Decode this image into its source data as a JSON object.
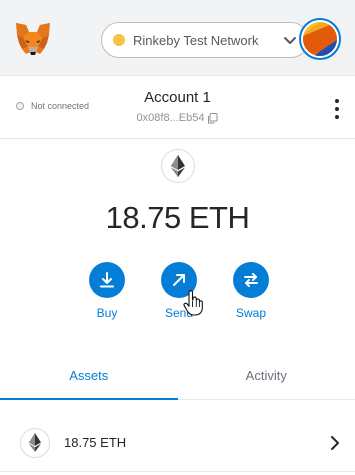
{
  "header": {
    "network": {
      "name": "Rinkeby Test Network",
      "dot_color": "#f6c343"
    },
    "logo_icon": "metamask-fox-icon",
    "avatar_icon": "account-identicon"
  },
  "account": {
    "connection_status": "Not connected",
    "name": "Account 1",
    "address_short": "0x08f8...Eb54",
    "copy_icon": "copy-icon",
    "menu_icon": "kebab-menu-icon"
  },
  "balance": {
    "amount": "18.75 ETH",
    "token_icon": "ethereum-icon"
  },
  "actions": [
    {
      "label": "Buy",
      "icon": "download-icon"
    },
    {
      "label": "Send",
      "icon": "arrow-up-right-icon"
    },
    {
      "label": "Swap",
      "icon": "swap-arrows-icon"
    }
  ],
  "tabs": [
    {
      "label": "Assets",
      "active": true
    },
    {
      "label": "Activity",
      "active": false
    }
  ],
  "assets": [
    {
      "amount": "18.75 ETH",
      "icon": "ethereum-icon"
    }
  ],
  "colors": {
    "accent": "#037dd6",
    "header_bg": "#f2f3f4"
  }
}
